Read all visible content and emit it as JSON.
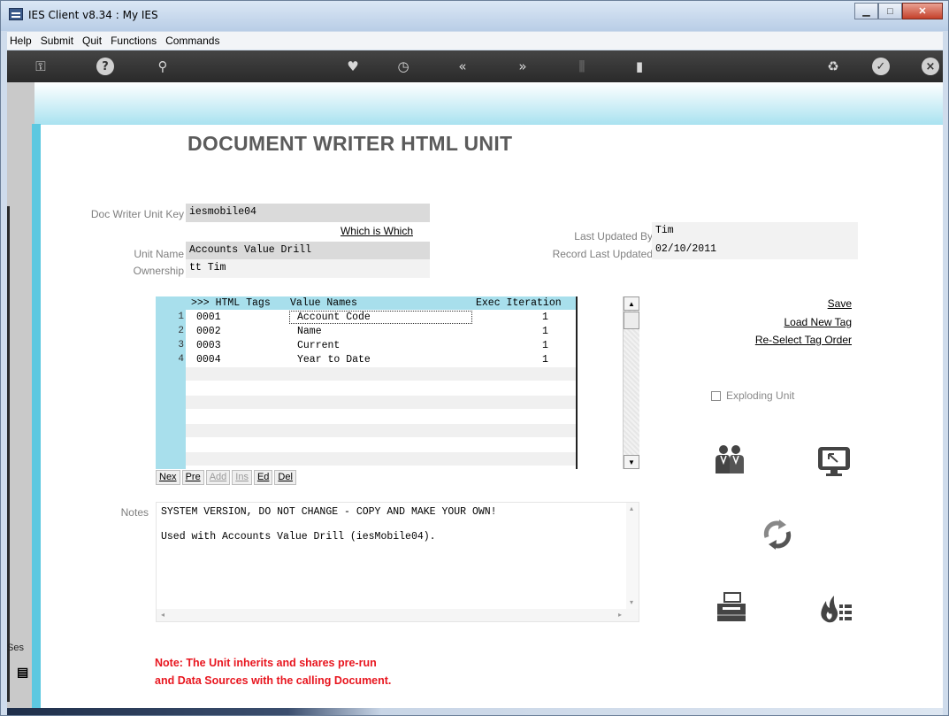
{
  "window": {
    "title": "IES Client v8.34 : My IES"
  },
  "menu": [
    "Help",
    "Submit",
    "Quit",
    "Functions",
    "Commands"
  ],
  "page": {
    "heading": "DOCUMENT WRITER HTML UNIT"
  },
  "form": {
    "doc_writer_unit_key_label": "Doc Writer Unit Key",
    "doc_writer_unit_key": "iesmobile04",
    "which_is_which": "Which is Which",
    "unit_name_label": "Unit Name",
    "unit_name": "Accounts Value Drill",
    "ownership_label": "Ownership",
    "ownership": "tt Tim",
    "last_updated_by_label": "Last Updated By",
    "last_updated_by": "Tim",
    "record_last_updated_label": "Record Last Updated",
    "record_last_updated": "02/10/2011"
  },
  "grid": {
    "headers": [
      ">>> HTML Tags",
      "Value Names",
      "Exec Iteration"
    ],
    "rows": [
      {
        "num": "1",
        "tag": "0001",
        "name": "Account Code",
        "iter": "1"
      },
      {
        "num": "2",
        "tag": "0002",
        "name": "Name",
        "iter": "1"
      },
      {
        "num": "3",
        "tag": "0003",
        "name": "Current",
        "iter": "1"
      },
      {
        "num": "4",
        "tag": "0004",
        "name": "Year to Date",
        "iter": "1"
      }
    ],
    "nav": [
      "Nex",
      "Pre",
      "Add",
      "Ins",
      "Ed",
      "Del"
    ]
  },
  "actions": {
    "save": "Save",
    "load_new_tag": "Load New Tag",
    "reselect_tag_order": "Re-Select Tag Order",
    "exploding_unit": "Exploding Unit"
  },
  "notes": {
    "label": "Notes",
    "line1": "SYSTEM VERSION, DO NOT CHANGE - COPY AND MAKE YOUR OWN!",
    "line2": "Used with Accounts Value Drill (iesMobile04)."
  },
  "footer_note": {
    "line1": "Note: The Unit inherits and shares pre-run",
    "line2": "and Data Sources with the calling Document."
  },
  "side": {
    "session_label": "Ses"
  },
  "icons": [
    "key-icon",
    "help-icon",
    "search-icon",
    "heart-icon",
    "clock-icon",
    "rewind-icon",
    "forward-icon",
    "tools-icon",
    "window-icon",
    "recycle-icon",
    "check-icon",
    "close-icon",
    "users-icon",
    "monitor-icon",
    "refresh-icon",
    "printer-icon",
    "fire-list-icon"
  ]
}
